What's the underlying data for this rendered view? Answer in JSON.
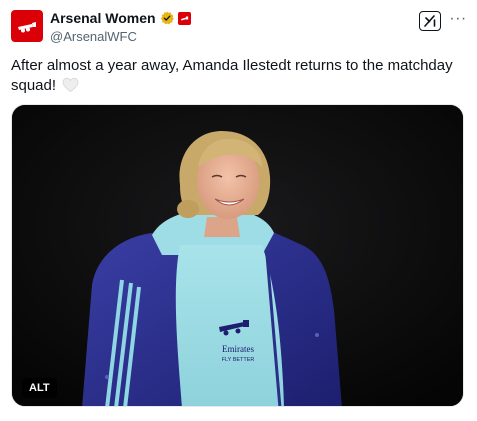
{
  "account": {
    "display_name": "Arsenal Women",
    "handle": "@ArsenalWFC",
    "avatar_icon": "arsenal-cannon-logo",
    "verified_icon": "gold-verified-badge",
    "affiliation_icon": "arsenal-affiliate-badge",
    "brand_color": "#db0007"
  },
  "actions": {
    "grok_icon": "grok-icon",
    "more_icon": "more-dots-icon",
    "more_label": "···"
  },
  "post": {
    "text": "After almost a year away, Amanda Ilestedt returns to the matchday squad!",
    "emoji_icon": "white-heart-icon"
  },
  "media": {
    "alt_label": "ALT",
    "shirt_sponsor_line1": "Emirates",
    "shirt_sponsor_line2": "FLY BETTER"
  }
}
